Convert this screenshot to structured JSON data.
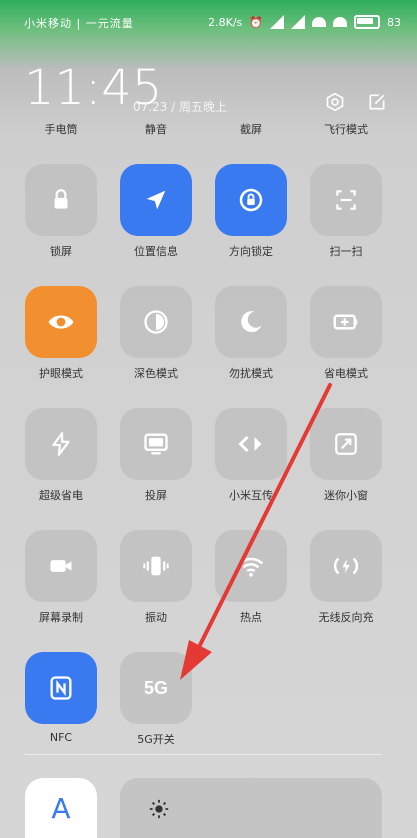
{
  "status_bar": {
    "carrier": "小米移动 | 一元流量",
    "speed": "2.8K/s",
    "battery": "83"
  },
  "header": {
    "time": "11:45",
    "date": "07.23 / 周五晚上",
    "icons": [
      "settings-icon",
      "edit-icon"
    ]
  },
  "top_row_labels": [
    "手电筒",
    "静音",
    "截屏",
    "飞行模式"
  ],
  "tiles": [
    {
      "label": "锁屏",
      "icon": "lock-icon",
      "active": false
    },
    {
      "label": "位置信息",
      "icon": "location-arrow-icon",
      "active": true,
      "color": "#3a7af0"
    },
    {
      "label": "方向锁定",
      "icon": "rotation-lock-icon",
      "active": true,
      "color": "#3a7af0"
    },
    {
      "label": "扫一扫",
      "icon": "scan-icon",
      "active": false
    },
    {
      "label": "护眼模式",
      "icon": "eye-icon",
      "active": true,
      "color": "#f28f2f"
    },
    {
      "label": "深色模式",
      "icon": "dark-mode-icon",
      "active": false
    },
    {
      "label": "勿扰模式",
      "icon": "moon-icon",
      "active": false
    },
    {
      "label": "省电模式",
      "icon": "battery-saver-icon",
      "active": false
    },
    {
      "label": "超级省电",
      "icon": "lightning-icon",
      "active": false
    },
    {
      "label": "投屏",
      "icon": "cast-screen-icon",
      "active": false
    },
    {
      "label": "小米互传",
      "icon": "mi-share-icon",
      "active": false
    },
    {
      "label": "迷你小窗",
      "icon": "mini-window-icon",
      "active": false
    },
    {
      "label": "屏幕录制",
      "icon": "screen-record-icon",
      "active": false
    },
    {
      "label": "振动",
      "icon": "vibrate-icon",
      "active": false
    },
    {
      "label": "热点",
      "icon": "hotspot-icon",
      "active": false
    },
    {
      "label": "无线反向充",
      "icon": "reverse-charge-icon",
      "active": false
    },
    {
      "label": "NFC",
      "icon": "nfc-icon",
      "active": true,
      "color": "#3a7af0"
    },
    {
      "label": "5G开关",
      "icon": "5g-icon",
      "active": false
    }
  ],
  "bottom": {
    "auto_label": "A",
    "brightness_icon": "sun-icon"
  },
  "annotation": {
    "arrow_color": "#e53935"
  }
}
